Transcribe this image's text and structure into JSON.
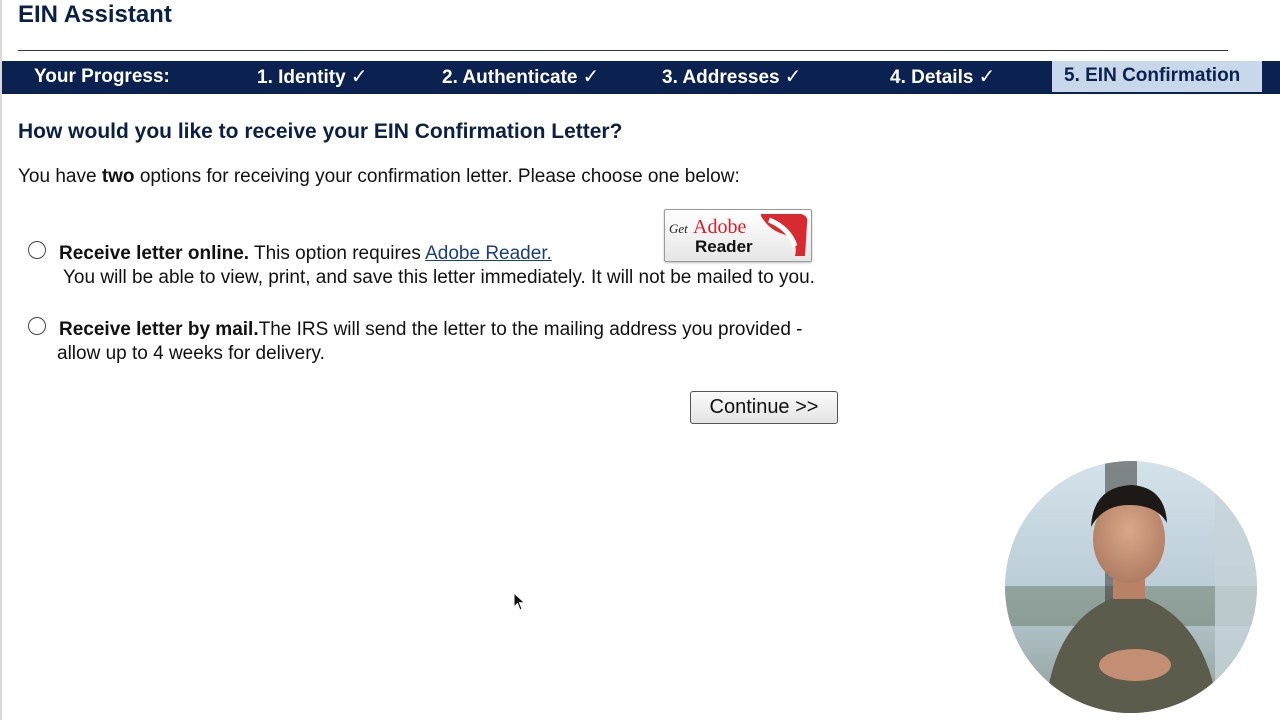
{
  "app": {
    "title": "EIN Assistant"
  },
  "progress": {
    "label": "Your Progress:",
    "steps": [
      {
        "label": "1. Identity",
        "check": "✓"
      },
      {
        "label": "2. Authenticate",
        "check": "✓"
      },
      {
        "label": "3. Addresses",
        "check": "✓"
      },
      {
        "label": "4. Details",
        "check": "✓"
      },
      {
        "label": "5. EIN Confirmation"
      }
    ]
  },
  "page": {
    "question": "How would you like to receive your EIN Confirmation Letter?",
    "intro_before": "You have ",
    "intro_bold": "two",
    "intro_after": " options for receiving your confirmation letter. Please choose one below:"
  },
  "options": {
    "online": {
      "title": "Receive letter online.",
      "text": " This option requires ",
      "link": "Adobe Reader.",
      "line2": "You will be able to view, print, and save this letter immediately. It will not be mailed to you.",
      "selected": false
    },
    "mail": {
      "title": "Receive letter by mail.",
      "text": "The IRS will send the letter to the mailing address you provided -",
      "line2": "allow up to 4 weeks for delivery.",
      "selected": false
    }
  },
  "adobe_badge": {
    "get": "Get",
    "adobe": "Adobe",
    "reader": "Reader"
  },
  "buttons": {
    "continue": "Continue >>"
  },
  "colors": {
    "navy": "#0b2150",
    "current_step_bg": "#c8d7ea",
    "link": "#1a3e80",
    "adobe_red": "#d51f26"
  },
  "icons": {
    "radio": "radio-button-icon",
    "check": "checkmark-icon",
    "cursor": "mouse-pointer-icon",
    "adobe": "adobe-reader-logo"
  }
}
